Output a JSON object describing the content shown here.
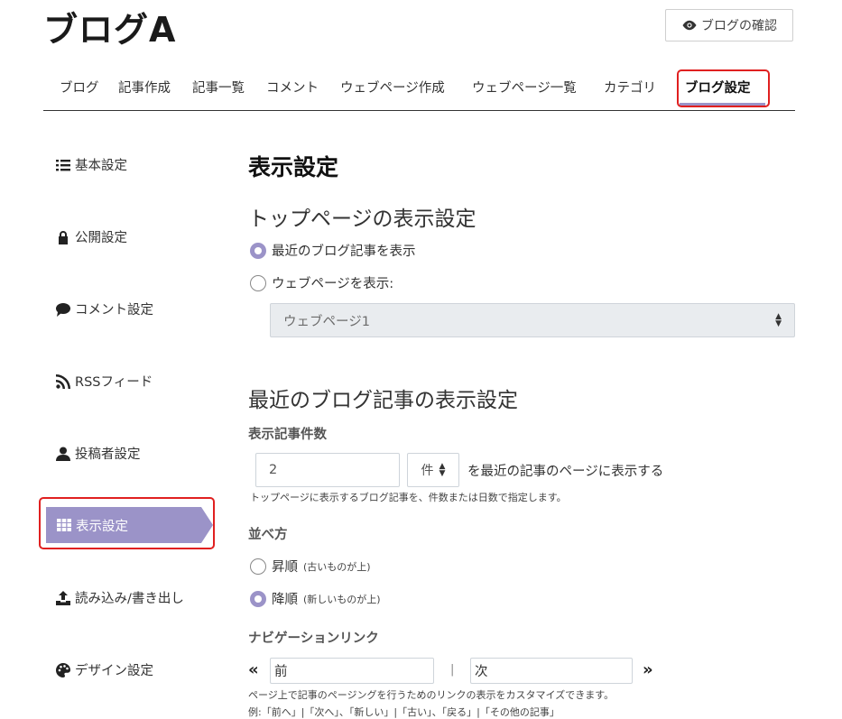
{
  "site_title": "ブログA",
  "preview_button": "ブログの確認",
  "nav": [
    "ブログ",
    "記事作成",
    "記事一覧",
    "コメント",
    "ウェブページ作成",
    "ウェブページ一覧",
    "カテゴリ",
    "ブログ設定"
  ],
  "sidebar": [
    {
      "label": "基本設定",
      "icon": "list-icon"
    },
    {
      "label": "公開設定",
      "icon": "lock-icon"
    },
    {
      "label": "コメント設定",
      "icon": "comment-icon"
    },
    {
      "label": "RSSフィード",
      "icon": "rss-icon"
    },
    {
      "label": "投稿者設定",
      "icon": "user-icon"
    },
    {
      "label": "表示設定",
      "icon": "grid-icon",
      "active": true
    },
    {
      "label": "読み込み/書き出し",
      "icon": "upload-icon"
    },
    {
      "label": "デザイン設定",
      "icon": "palette-icon"
    }
  ],
  "main": {
    "title": "表示設定",
    "top_page": {
      "heading": "トップページの表示設定",
      "option_recent": "最近のブログ記事を表示",
      "option_webpage": "ウェブページを表示:",
      "webpage_select": "ウェブページ1"
    },
    "recent": {
      "heading": "最近のブログ記事の表示設定",
      "count_label": "表示記事件数",
      "count_value": "2",
      "unit": "件",
      "count_suffix": "を最近の記事のページに表示する",
      "count_help": "トップページに表示するブログ記事を、件数または日数で指定します。",
      "order_label": "並べ方",
      "asc_label": "昇順",
      "asc_note": "(古いものが上)",
      "desc_label": "降順",
      "desc_note": "(新しいものが上)",
      "nav_label": "ナビゲーションリンク",
      "prev_value": "前",
      "separator": "|",
      "next_value": "次",
      "nav_help": "ページ上で記事のページングを行うためのリンクの表示をカスタマイズできます。",
      "nav_example": "例:「前へ」|「次へ」、「新しい」|「古い」、「戻る」|「その他の記事」"
    }
  },
  "colors": {
    "accent": "#9b93c8",
    "highlight": "#e02020"
  }
}
